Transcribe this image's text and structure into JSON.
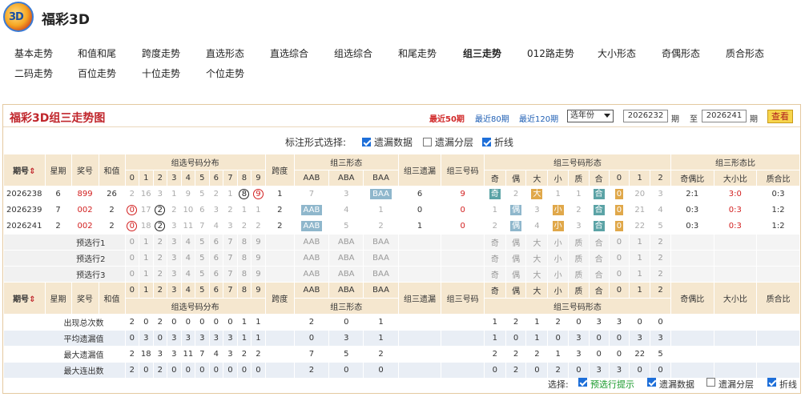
{
  "header": {
    "logo_text": "3D",
    "title": "福彩3D"
  },
  "nav": {
    "row1": [
      "基本走势",
      "和值和尾",
      "跨度走势",
      "直选形态",
      "直选综合",
      "组选综合",
      "和尾走势",
      "组三走势",
      "012路走势",
      "大小形态",
      "奇偶形态",
      "质合形态"
    ],
    "row2": [
      "二码走势",
      "百位走势",
      "十位走势",
      "个位走势"
    ]
  },
  "panel": {
    "title": "福彩3D组三走势图",
    "ranges": [
      "最近50期",
      "最近80期",
      "最近120期"
    ],
    "year_select": "选年份",
    "from_issue": "2026232",
    "to_issue": "2026241",
    "issue_unit": "期",
    "to_word": "至",
    "view_button": "查看",
    "mark_label": "标注形式选择:",
    "opt1": "遗漏数据",
    "opt2": "遗漏分层",
    "opt3": "折线"
  },
  "table": {
    "h_issue": "期号",
    "h_week": "星期",
    "h_prize": "奖号",
    "h_sum": "和值",
    "h_dist": "组选号码分布",
    "h_span": "跨度",
    "h_form": "组三形态",
    "h_omit": "组三遗漏",
    "h_code": "组三号码",
    "h_shape": "组三号码形态",
    "h_ratio": "组三形态比",
    "forms": [
      "AAB",
      "ABA",
      "BAA"
    ],
    "shapes": [
      "奇",
      "偶",
      "大",
      "小",
      "质",
      "合",
      "0",
      "1",
      "2"
    ],
    "ratios": [
      "奇偶比",
      "大小比",
      "质合比"
    ],
    "rows": [
      {
        "issue": "2026238",
        "week": "6",
        "prize": "899",
        "sum": "26",
        "dist": [
          "2",
          "16",
          "3",
          "1",
          "9",
          "5",
          "2",
          "1",
          "8",
          "9"
        ],
        "span": "1",
        "form": [
          "7",
          "3",
          "BAA"
        ],
        "omit": "6",
        "code": "9",
        "shape": [
          "奇",
          "2",
          "大",
          "1",
          "1",
          "合",
          "0",
          "20",
          "3"
        ],
        "ratio": [
          "2:1",
          "3:0",
          "0:3"
        ]
      },
      {
        "issue": "2026239",
        "week": "7",
        "prize": "002",
        "sum": "2",
        "dist": [
          "0",
          "17",
          "2",
          "2",
          "10",
          "6",
          "3",
          "2",
          "1",
          "1"
        ],
        "span": "2",
        "form": [
          "AAB",
          "4",
          "1"
        ],
        "omit": "0",
        "code": "0",
        "shape": [
          "1",
          "偶",
          "3",
          "小",
          "2",
          "合",
          "0",
          "21",
          "4"
        ],
        "ratio": [
          "0:3",
          "0:3",
          "1:2"
        ]
      },
      {
        "issue": "2026241",
        "week": "2",
        "prize": "002",
        "sum": "2",
        "dist": [
          "0",
          "18",
          "2",
          "3",
          "11",
          "7",
          "4",
          "3",
          "2",
          "2"
        ],
        "span": "2",
        "form": [
          "AAB",
          "5",
          "2"
        ],
        "omit": "1",
        "code": "0",
        "shape": [
          "2",
          "偶",
          "4",
          "小",
          "3",
          "合",
          "0",
          "22",
          "5"
        ],
        "ratio": [
          "0:3",
          "0:3",
          "1:2"
        ]
      }
    ],
    "pred_rows": [
      "预选行1",
      "预选行2",
      "预选行3"
    ],
    "digits": [
      "0",
      "1",
      "2",
      "3",
      "4",
      "5",
      "6",
      "7",
      "8",
      "9"
    ],
    "stats": [
      {
        "label": "出现总次数",
        "dist": [
          "2",
          "0",
          "2",
          "0",
          "0",
          "0",
          "0",
          "0",
          "1",
          "1"
        ],
        "form": [
          "2",
          "0",
          "1"
        ],
        "shape": [
          "1",
          "2",
          "1",
          "2",
          "0",
          "3",
          "3",
          "0",
          "0"
        ]
      },
      {
        "label": "平均遗漏值",
        "dist": [
          "0",
          "3",
          "0",
          "3",
          "3",
          "3",
          "3",
          "3",
          "1",
          "1"
        ],
        "form": [
          "0",
          "3",
          "1"
        ],
        "shape": [
          "1",
          "0",
          "1",
          "0",
          "3",
          "0",
          "0",
          "3",
          "3"
        ]
      },
      {
        "label": "最大遗漏值",
        "dist": [
          "2",
          "18",
          "3",
          "3",
          "11",
          "7",
          "4",
          "3",
          "2",
          "2"
        ],
        "form": [
          "7",
          "5",
          "2"
        ],
        "shape": [
          "2",
          "2",
          "2",
          "1",
          "3",
          "0",
          "0",
          "22",
          "5"
        ]
      },
      {
        "label": "最大连出数",
        "dist": [
          "2",
          "0",
          "2",
          "0",
          "0",
          "0",
          "0",
          "0",
          "0",
          "0"
        ],
        "form": [
          "2",
          "0",
          "0"
        ],
        "shape": [
          "0",
          "2",
          "0",
          "2",
          "0",
          "3",
          "3",
          "0",
          "0"
        ]
      }
    ]
  },
  "footer": {
    "label": "选择:",
    "o1": "预选行提示",
    "o2": "遗漏数据",
    "o3": "遗漏分层",
    "o4": "折线"
  },
  "colors": {
    "accent": "#c0262c",
    "header_bg": "#f5e7cf",
    "link": "#1f5fb4"
  }
}
